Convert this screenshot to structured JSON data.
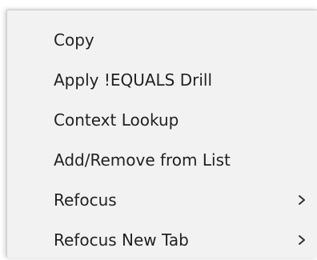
{
  "context_menu": {
    "items": [
      {
        "label": "Copy",
        "has_submenu": false
      },
      {
        "label": "Apply !EQUALS Drill",
        "has_submenu": false
      },
      {
        "label": "Context Lookup",
        "has_submenu": false
      },
      {
        "label": "Add/Remove from List",
        "has_submenu": false
      },
      {
        "label": "Refocus",
        "has_submenu": true,
        "submenu_icon": "chevron-right-icon"
      },
      {
        "label": "Refocus New Tab",
        "has_submenu": true,
        "submenu_icon": "chevron-right-icon"
      }
    ],
    "colors": {
      "background": "#f2f2f2",
      "text": "#222222",
      "border": "#cfcfcf"
    }
  }
}
